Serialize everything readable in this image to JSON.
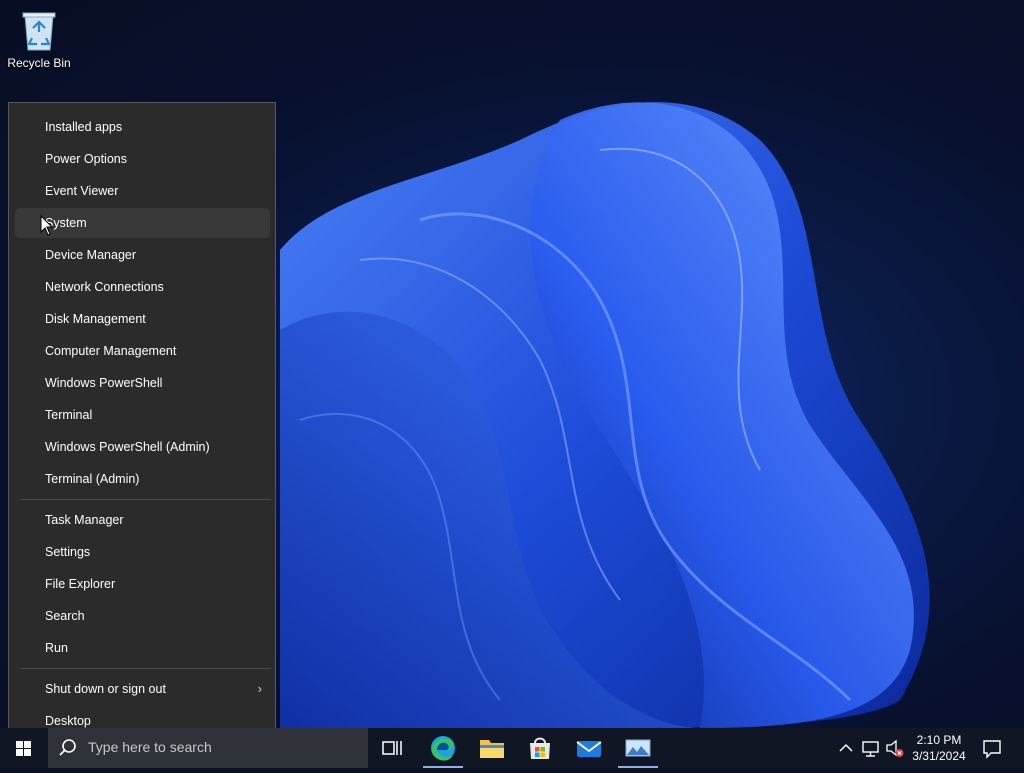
{
  "desktop": {
    "icons": [
      {
        "label": "Recycle Bin",
        "icon": "recycle-bin-icon"
      }
    ]
  },
  "context_menu": {
    "group1": [
      {
        "label": "Installed apps"
      },
      {
        "label": "Power Options"
      },
      {
        "label": "Event Viewer"
      },
      {
        "label": "System"
      },
      {
        "label": "Device Manager"
      },
      {
        "label": "Network Connections"
      },
      {
        "label": "Disk Management"
      },
      {
        "label": "Computer Management"
      },
      {
        "label": "Windows PowerShell"
      },
      {
        "label": "Terminal"
      },
      {
        "label": "Windows PowerShell (Admin)"
      },
      {
        "label": "Terminal (Admin)"
      }
    ],
    "group2": [
      {
        "label": "Task Manager"
      },
      {
        "label": "Settings"
      },
      {
        "label": "File Explorer"
      },
      {
        "label": "Search"
      },
      {
        "label": "Run"
      }
    ],
    "group3": [
      {
        "label": "Shut down or sign out",
        "submenu_glyph": "›"
      },
      {
        "label": "Desktop"
      }
    ],
    "hovered_item": "System"
  },
  "taskbar": {
    "search_placeholder": "Type here to search",
    "apps": [
      "task-view-icon",
      "edge-icon",
      "file-explorer-icon",
      "microsoft-store-icon",
      "mail-icon",
      "photos-icon"
    ],
    "tray_icons": [
      "chevron-up-icon",
      "network-icon",
      "volume-muted-icon"
    ],
    "clock": {
      "time": "2:10 PM",
      "date": "3/31/2024"
    },
    "notification_icon": "notification-icon"
  },
  "colors": {
    "menu_bg": "#2b2b2b",
    "menu_hover": "#383838",
    "taskbar_bg": "#101623",
    "search_bg": "#2e3138",
    "accent_blue": "#2f6ff0"
  }
}
